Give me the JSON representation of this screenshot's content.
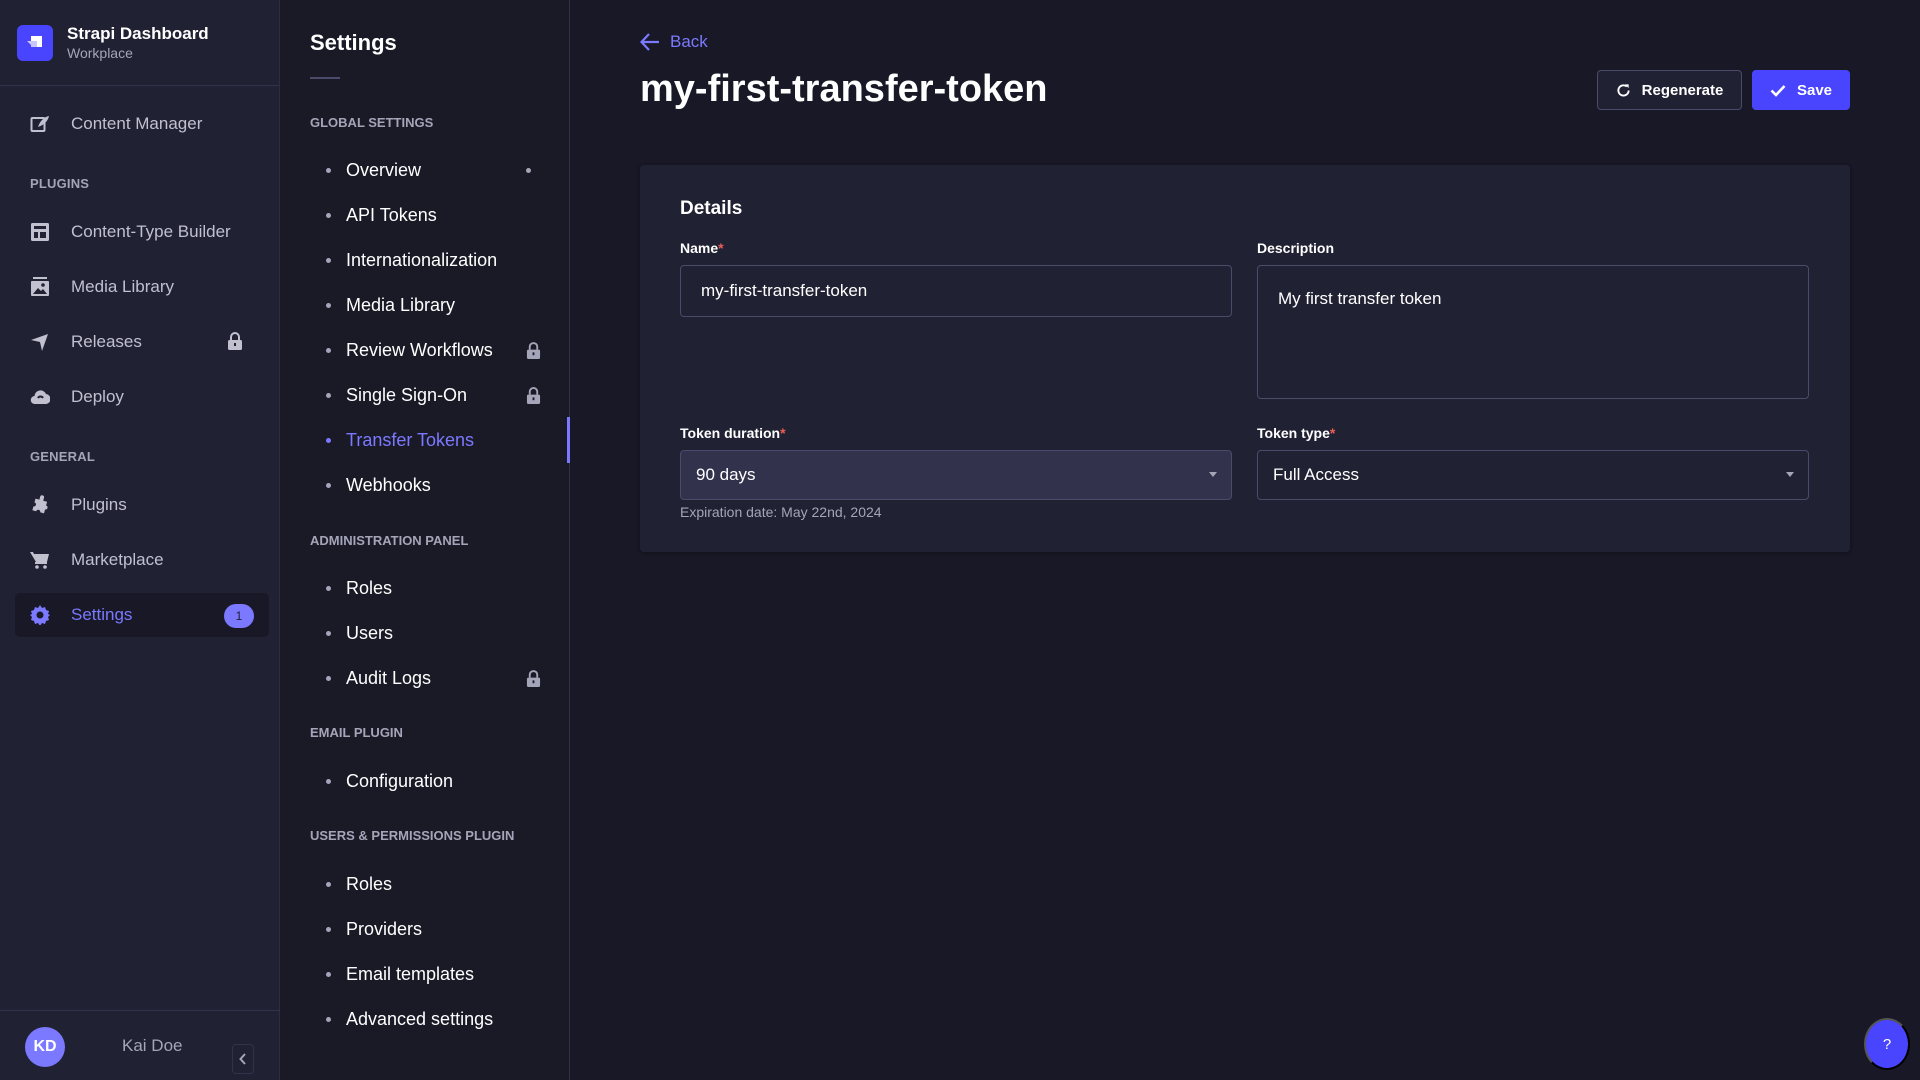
{
  "brand": {
    "title": "Strapi Dashboard",
    "subtitle": "Workplace"
  },
  "mainnav": {
    "items": [
      {
        "label": "Content Manager",
        "icon": "content-manager-icon"
      },
      {
        "label": "Content-Type Builder",
        "icon": "layout-icon"
      },
      {
        "label": "Media Library",
        "icon": "image-icon"
      },
      {
        "label": "Releases",
        "icon": "paper-plane-icon",
        "locked": true
      },
      {
        "label": "Deploy",
        "icon": "cloud-icon"
      },
      {
        "label": "Plugins",
        "icon": "puzzle-icon"
      },
      {
        "label": "Marketplace",
        "icon": "cart-icon"
      },
      {
        "label": "Settings",
        "icon": "gear-icon",
        "badge": "1",
        "active": true
      }
    ],
    "sections": {
      "plugins": "PLUGINS",
      "general": "GENERAL"
    },
    "user": {
      "initials": "KD",
      "name": "Kai Doe"
    }
  },
  "subnav": {
    "title": "Settings",
    "sections": [
      {
        "title": "GLOBAL SETTINGS",
        "items": [
          {
            "label": "Overview",
            "indicator": true
          },
          {
            "label": "API Tokens"
          },
          {
            "label": "Internationalization"
          },
          {
            "label": "Media Library"
          },
          {
            "label": "Review Workflows",
            "locked": true
          },
          {
            "label": "Single Sign-On",
            "locked": true
          },
          {
            "label": "Transfer Tokens",
            "active": true
          },
          {
            "label": "Webhooks"
          }
        ]
      },
      {
        "title": "ADMINISTRATION PANEL",
        "items": [
          {
            "label": "Roles"
          },
          {
            "label": "Users"
          },
          {
            "label": "Audit Logs",
            "locked": true
          }
        ]
      },
      {
        "title": "EMAIL PLUGIN",
        "items": [
          {
            "label": "Configuration"
          }
        ]
      },
      {
        "title": "USERS & PERMISSIONS PLUGIN",
        "items": [
          {
            "label": "Roles"
          },
          {
            "label": "Providers"
          },
          {
            "label": "Email templates"
          },
          {
            "label": "Advanced settings"
          }
        ]
      }
    ]
  },
  "main": {
    "back_label": "Back",
    "title": "my-first-transfer-token",
    "regenerate_label": "Regenerate",
    "save_label": "Save",
    "details": {
      "title": "Details",
      "name_label": "Name",
      "name_value": "my-first-transfer-token",
      "description_label": "Description",
      "description_value": "My first transfer token",
      "duration_label": "Token duration",
      "duration_value": "90 days",
      "expiration_hint": "Expiration date: May 22nd, 2024",
      "type_label": "Token type",
      "type_value": "Full Access",
      "required_mark": "*"
    },
    "help_label": "?"
  },
  "colors": {
    "accent": "#4945ff",
    "accent_light": "#7b79ff",
    "danger": "#ee5e52",
    "surface": "#212134",
    "background": "#181826"
  }
}
